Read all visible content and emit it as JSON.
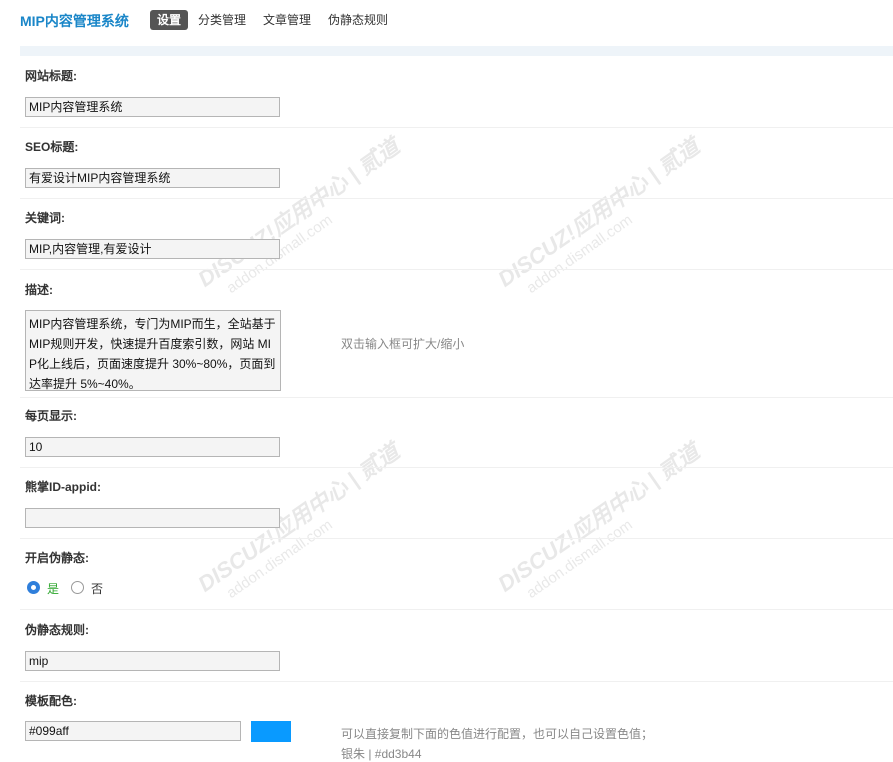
{
  "nav": {
    "brand": "MIP内容管理系统",
    "items": [
      "设置",
      "分类管理",
      "文章管理",
      "伪静态规则"
    ]
  },
  "form": {
    "site_title": {
      "label": "网站标题:",
      "value": "MIP内容管理系统"
    },
    "seo_title": {
      "label": "SEO标题:",
      "value": "有爱设计MIP内容管理系统"
    },
    "keywords": {
      "label": "关键词:",
      "value": "MIP,内容管理,有爱设计"
    },
    "description": {
      "label": "描述:",
      "value": "MIP内容管理系统，专门为MIP而生，全站基于MIP规则开发，快速提升百度索引数，网站 MIP化上线后，页面速度提升 30%~80%，页面到达率提升 5%~40%。",
      "hint": "双击输入框可扩大/缩小"
    },
    "per_page": {
      "label": "每页显示:",
      "value": "10"
    },
    "appid": {
      "label": "熊掌ID-appid:",
      "value": ""
    },
    "rewrite_enable": {
      "label": "开启伪静态:",
      "options": [
        "是",
        "否"
      ],
      "selected": "是"
    },
    "rewrite_rule": {
      "label": "伪静态规则:",
      "value": "mip"
    },
    "theme_color": {
      "label": "模板配色:",
      "value": "#099aff",
      "swatch": "#099aff",
      "hint": "可以直接复制下面的色值进行配置，也可以自己设置色值；",
      "hint2": "银朱 | #dd3b44"
    }
  },
  "watermark": {
    "line1": "DISCUZ!应用中心 | 贰道",
    "line2": "addon.dismall.com"
  },
  "colors": {
    "accent": "#1a86c8",
    "radio": "#2f7fdb",
    "selected_label": "#2aa52a"
  }
}
